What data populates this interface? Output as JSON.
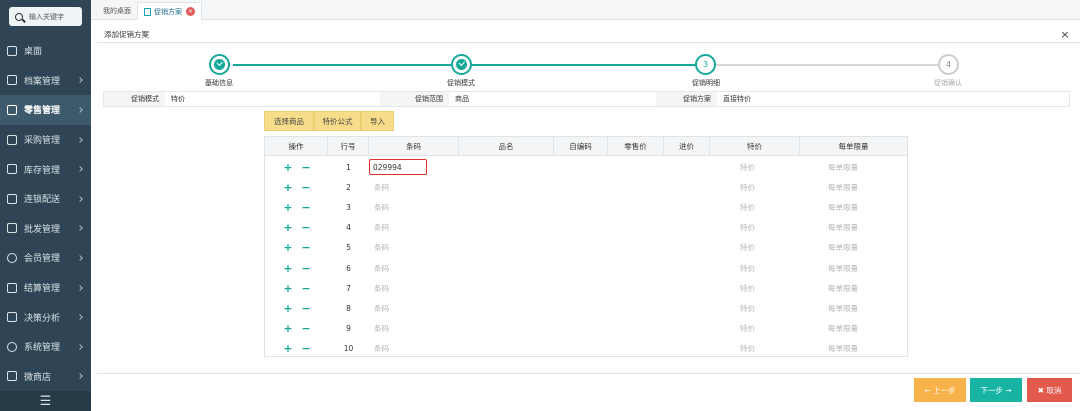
{
  "sidebar": {
    "search_placeholder": "输入关键字",
    "items": [
      {
        "label": "桌面",
        "icon": "monitor-icon",
        "arrow": false
      },
      {
        "label": "档案管理",
        "icon": "archive-icon",
        "arrow": true
      },
      {
        "label": "零售管理",
        "icon": "store-icon",
        "arrow": true,
        "active": true
      },
      {
        "label": "采购管理",
        "icon": "cart-icon",
        "arrow": true
      },
      {
        "label": "库存管理",
        "icon": "warehouse-icon",
        "arrow": true
      },
      {
        "label": "连锁配送",
        "icon": "delivery-icon",
        "arrow": true
      },
      {
        "label": "批发管理",
        "icon": "wholesale-icon",
        "arrow": true
      },
      {
        "label": "会员管理",
        "icon": "member-icon",
        "arrow": true
      },
      {
        "label": "结算管理",
        "icon": "settlement-icon",
        "arrow": true
      },
      {
        "label": "决策分析",
        "icon": "analysis-icon",
        "arrow": true
      },
      {
        "label": "系统管理",
        "icon": "gear-icon",
        "arrow": true
      },
      {
        "label": "微商店",
        "icon": "shop-icon",
        "arrow": true
      }
    ],
    "footer_icon": "menu-icon"
  },
  "tabs": [
    {
      "label": "我的桌面"
    },
    {
      "label": "促销方案",
      "active": true,
      "closable": true
    }
  ],
  "dialog": {
    "title": "添加促销方案",
    "close_symbol": "×"
  },
  "steps": [
    {
      "label": "基础信息",
      "state": "done",
      "number": "1"
    },
    {
      "label": "促销模式",
      "state": "done",
      "number": "2"
    },
    {
      "label": "促销明细",
      "state": "current",
      "number": "3"
    },
    {
      "label": "促销确认",
      "state": "todo",
      "number": "4"
    }
  ],
  "info": {
    "mode_label": "促销模式",
    "mode_value": "特价",
    "scope_label": "促销范围",
    "scope_value": "商品",
    "plan_label": "促销方案",
    "plan_value": "直接特价"
  },
  "toolbar": {
    "select_goods": "选择商品",
    "price_formula": "特价公式",
    "import": "导入"
  },
  "grid": {
    "headers": [
      "操作",
      "行号",
      "条码",
      "品名",
      "自编码",
      "零售价",
      "进价",
      "特价",
      "每单限量"
    ],
    "barcode_placeholder": "条码",
    "special_placeholder": "特价",
    "limit_placeholder": "每单限量",
    "plus_symbol": "+",
    "minus_symbol": "−",
    "first_barcode_value": "029994",
    "rows": [
      "1",
      "2",
      "3",
      "4",
      "5",
      "6",
      "7",
      "8",
      "9",
      "10"
    ]
  },
  "footer": {
    "prev_label": "← 上一步",
    "next_label": "下一步 →",
    "cancel_label": "✖ 取消"
  },
  "colors": {
    "sidebar_bg": "#2f4555",
    "accent": "#16a99a",
    "toolbar_btn": "#f7dd8a",
    "prev_btn": "#f7b24a",
    "next_btn": "#17b3a3",
    "cancel_btn": "#e35a4d"
  }
}
